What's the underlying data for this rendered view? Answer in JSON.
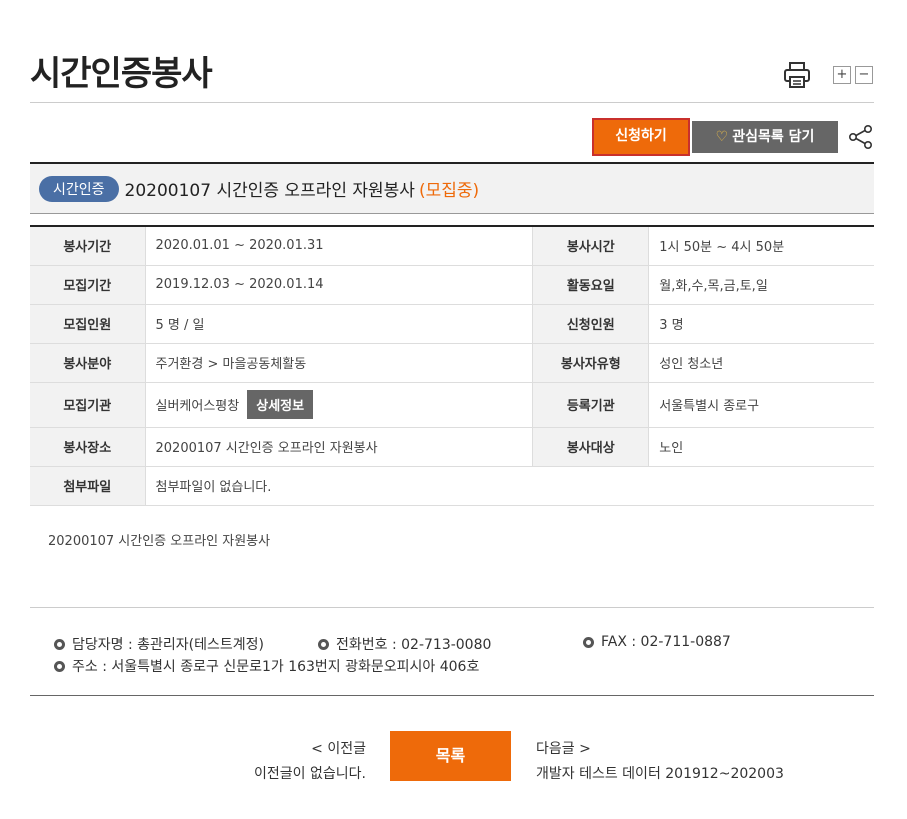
{
  "page": {
    "title": "시간인증봉사"
  },
  "tools": {
    "zoom_in": "+",
    "zoom_out": "−"
  },
  "actions": {
    "apply_label": "신청하기",
    "favorite_label": "관심목록 담기"
  },
  "header": {
    "badge": "시간인증",
    "title": "20200107 시간인증 오프라인 자원봉사",
    "status": "(모집중)"
  },
  "info": {
    "rows": [
      {
        "l1": "봉사기간",
        "v1": "2020.01.01 ~ 2020.01.31",
        "l2": "봉사시간",
        "v2": "1시 50분 ~ 4시 50분"
      },
      {
        "l1": "모집기간",
        "v1": "2019.12.03 ~ 2020.01.14",
        "l2": "활동요일",
        "v2": "월,화,수,목,금,토,일"
      },
      {
        "l1": "모집인원",
        "v1": "5 명 / 일",
        "l2": "신청인원",
        "v2": "3 명"
      },
      {
        "l1": "봉사분야",
        "v1": "주거환경 > 마을공동체활동",
        "l2": "봉사자유형",
        "v2": "성인  청소년"
      },
      {
        "l1": "모집기관",
        "v1": "실버케어스평창",
        "v1_button": "상세정보",
        "l2": "등록기관",
        "v2": "서울특별시 종로구"
      },
      {
        "l1": "봉사장소",
        "v1": "20200107 시간인증 오프라인 자원봉사",
        "l2": "봉사대상",
        "v2": "노인"
      },
      {
        "l1": "첨부파일",
        "v1": "첨부파일이 없습니다."
      }
    ]
  },
  "description": "20200107 시간인증 오프라인 자원봉사",
  "contact": {
    "manager": "담당자명 : 총관리자(테스트계정)",
    "phone": "전화번호 : 02-713-0080",
    "fax": "FAX : 02-711-0887",
    "address": "주소 : 서울특별시 종로구 신문로1가 163번지 광화문오피시아 406호"
  },
  "nav": {
    "prev_label": "< 이전글",
    "prev_text": "이전글이 없습니다.",
    "list_label": "목록",
    "next_label": "다음글 >",
    "next_text": "개발자 테스트 데이터 201912~202003"
  },
  "colors": {
    "accent": "#ee6a0a",
    "badge": "#4a6fa5",
    "dark_button": "#666666"
  },
  "icons": {
    "print": "printer-icon",
    "share": "share-icon",
    "heart": "heart-icon"
  }
}
